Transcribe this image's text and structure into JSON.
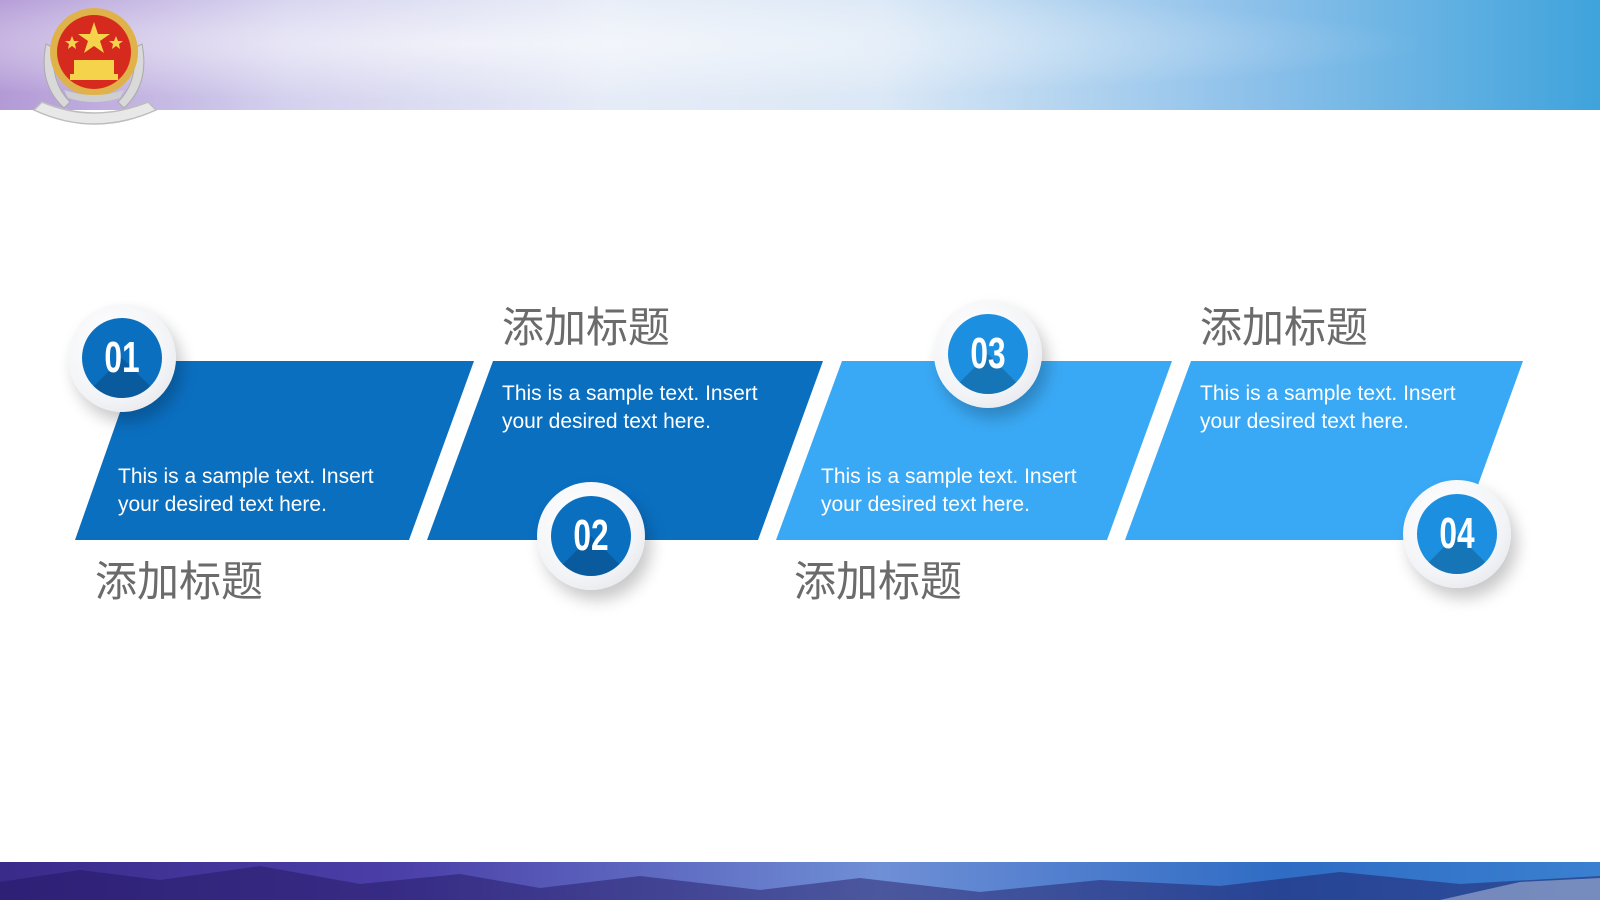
{
  "colors": {
    "dark_blue": "#0b6fc0",
    "light_blue": "#3aa9f5",
    "heading_gray": "#6b6b6b"
  },
  "steps": [
    {
      "number": "01",
      "heading": "添加标题",
      "text": "This is a sample text. Insert your desired text here."
    },
    {
      "number": "02",
      "heading": "添加标题",
      "text": "This is a sample text. Insert your desired text here."
    },
    {
      "number": "03",
      "heading": "添加标题",
      "text": "This is a sample text. Insert your desired text here."
    },
    {
      "number": "04",
      "heading": "添加标题",
      "text": "This is a sample text. Insert your desired text here."
    }
  ]
}
